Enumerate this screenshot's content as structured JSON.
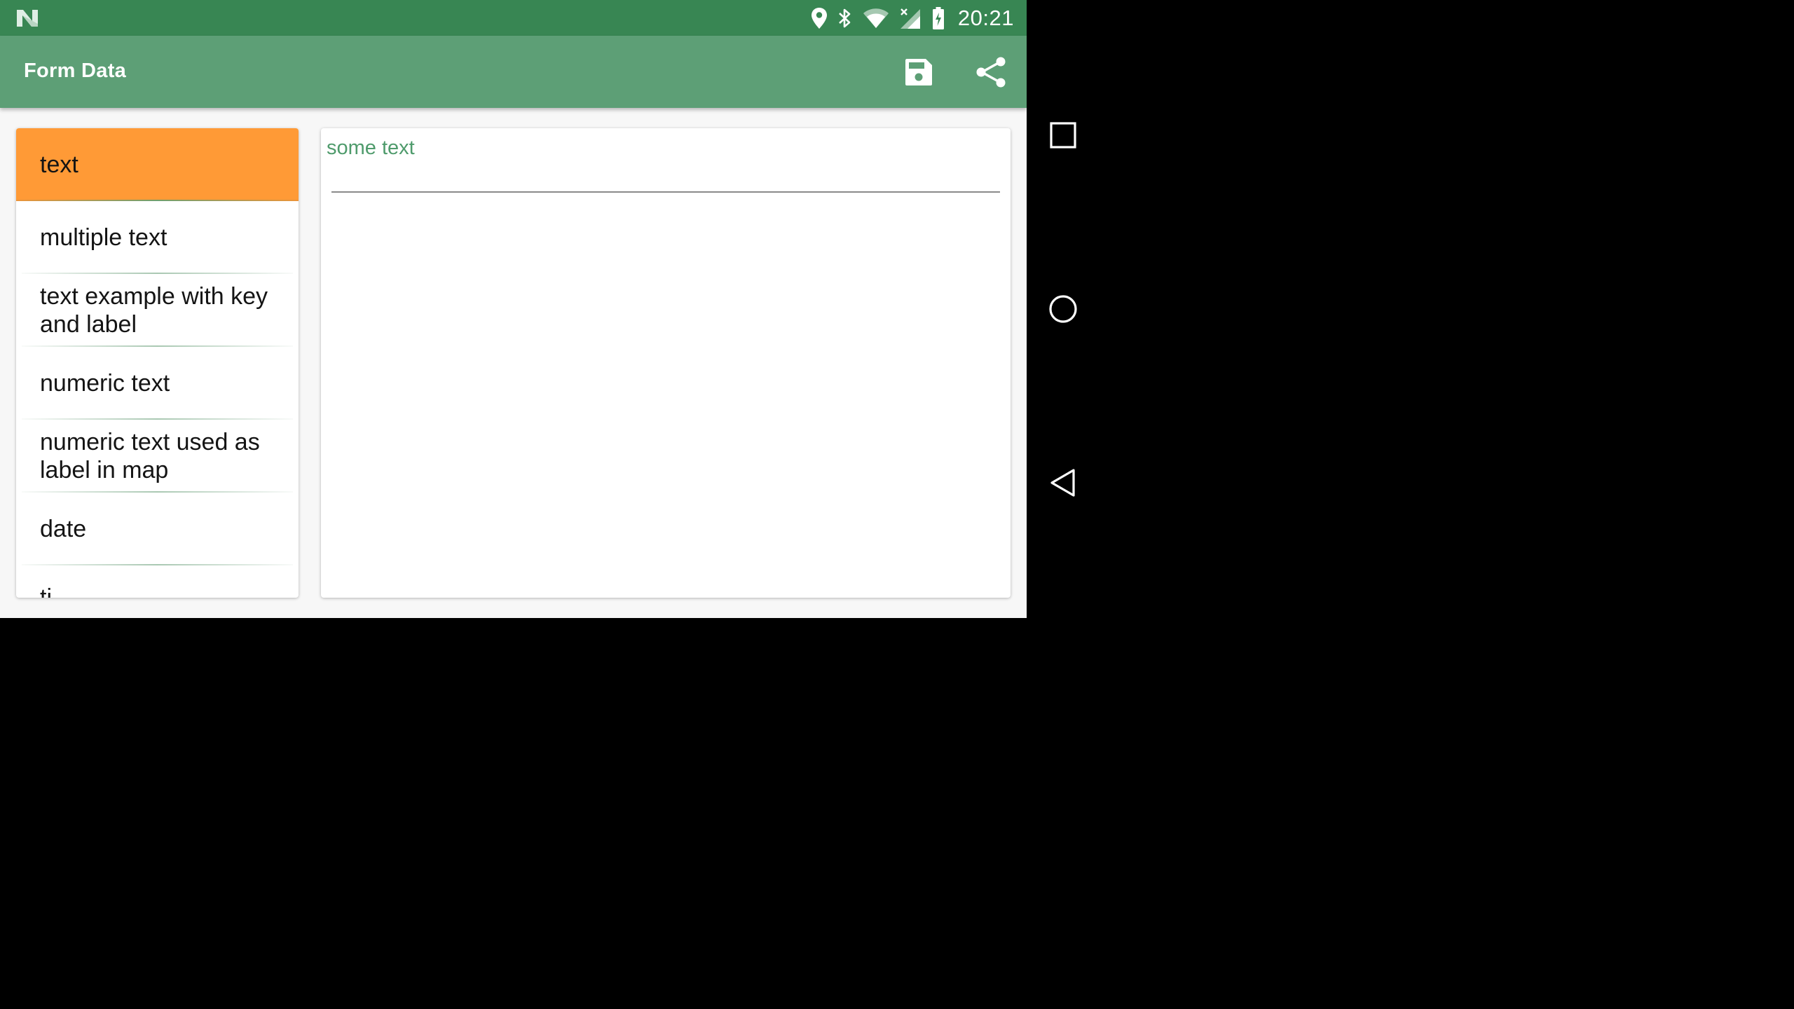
{
  "status_bar": {
    "time": "20:21",
    "icons": [
      "n-notification-icon",
      "location-icon",
      "bluetooth-icon",
      "wifi-icon",
      "signal-no-data-icon",
      "battery-charging-icon"
    ]
  },
  "app_bar": {
    "title": "Form Data",
    "actions": [
      "save-icon",
      "share-icon"
    ]
  },
  "list": {
    "items": [
      {
        "label": "text",
        "selected": true
      },
      {
        "label": "multiple text",
        "selected": false
      },
      {
        "label": "text example with key and label",
        "selected": false
      },
      {
        "label": "numeric text",
        "selected": false
      },
      {
        "label": "numeric text used as label in map",
        "selected": false
      },
      {
        "label": "date",
        "selected": false
      },
      {
        "label": "ti",
        "selected": false
      }
    ]
  },
  "detail": {
    "field_value": "some text",
    "input_value": ""
  },
  "nav_bar": {
    "buttons": [
      "recents-icon",
      "home-icon",
      "back-icon"
    ]
  },
  "colors": {
    "status_bar": "#388653",
    "app_bar": "#5d9f76",
    "selected_item": "#ff9a36",
    "field_text": "#4f9b6c"
  }
}
